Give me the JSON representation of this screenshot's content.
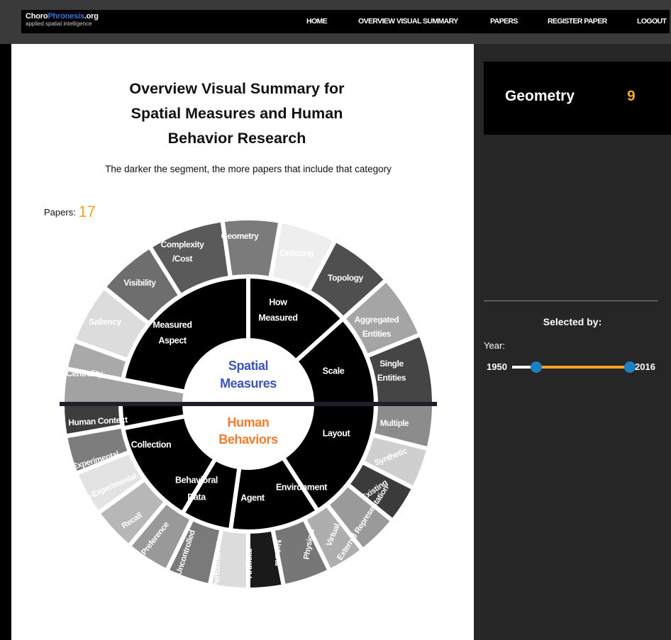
{
  "logo": {
    "part1": "Choro",
    "part2": "Phronesis",
    "part3": ".org",
    "tagline": "applied spatial intelligence"
  },
  "nav": [
    "HOME",
    "OVERVIEW VISUAL SUMMARY",
    "PAPERS",
    "REGISTER PAPER",
    "LOGOUT"
  ],
  "title_lines": [
    "Overview Visual Summary for",
    "Spatial Measures and Human",
    "Behavior Research"
  ],
  "subtitle": "The darker the segment, the more papers that include that category",
  "papers_label": "Papers:",
  "papers_count": "17",
  "tooltip": {
    "label": "Geometry",
    "value": "9"
  },
  "selected_by": "Selected by:",
  "year_filter": {
    "label": "Year:",
    "min": "1950",
    "max": "2016"
  },
  "sunburst": {
    "top_center": [
      "Spatial",
      "Measures"
    ],
    "bottom_center": [
      "Human",
      "Behaviors"
    ],
    "colors": {
      "top_center": "#3c55b7",
      "bottom_center": "#f07c2e",
      "divider": "#241b30",
      "black": "#000000"
    },
    "inner_top": [
      {
        "label": "Measured Aspect"
      },
      {
        "label": "How Measured"
      },
      {
        "label": "Scale"
      }
    ],
    "inner_bottom": [
      {
        "label": "Layout"
      },
      {
        "label": "Environment"
      },
      {
        "label": "Agent"
      },
      {
        "label": "Behavioral Data"
      },
      {
        "label": "Collection"
      },
      {
        "label": "Human Context"
      }
    ],
    "outer_top": [
      {
        "label": "Centrality",
        "color": "#a9a9a9"
      },
      {
        "label": "Saliency",
        "color": "#dcdcdc"
      },
      {
        "label": "Visibility",
        "color": "#6e6e6e"
      },
      {
        "label": "Complexity /Cost",
        "color": "#5a5a5a"
      },
      {
        "label": "Geometry",
        "color": "#7b7b7b"
      },
      {
        "label": "Ordering",
        "color": "#eeeeee"
      },
      {
        "label": "Topology",
        "color": "#4f4f4f"
      },
      {
        "label": "Aggregated Entities",
        "color": "#a5a5a5"
      },
      {
        "label": "Single Entities",
        "color": "#454545"
      }
    ],
    "outer_bottom": [
      {
        "label": "Multiple",
        "color": "#8c8c8c"
      },
      {
        "label": "Synthetic",
        "color": "#cfcfcf"
      },
      {
        "label": "Existing",
        "color": "#3b3b3b"
      },
      {
        "label": "External Representation",
        "color": "#9a9a9a"
      },
      {
        "label": "Virtual",
        "color": "#aeaeae"
      },
      {
        "label": "Physical",
        "color": "#777777"
      },
      {
        "label": "Natural",
        "color": "#1a1a1a"
      },
      {
        "label": "Artificial",
        "color": "#dcdcdc"
      },
      {
        "label": "Performance",
        "color": "#7a7a7a"
      },
      {
        "label": "Uncontrolled",
        "color": "#999999"
      },
      {
        "label": "Preference",
        "color": "#b7b7b7"
      },
      {
        "label": "Recall",
        "color": "#e3e3e3"
      },
      {
        "label": "Non-Experimental",
        "color": "#7d7d7d"
      },
      {
        "label": "Experimental",
        "color": "#3d3d3d"
      }
    ]
  }
}
